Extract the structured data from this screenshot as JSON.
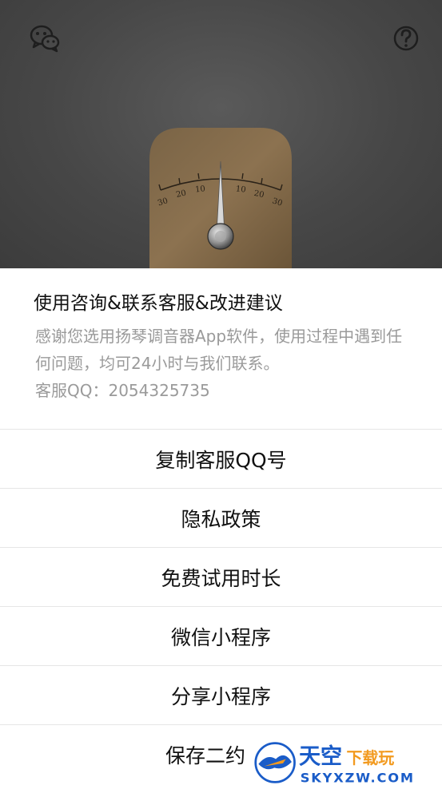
{
  "dialog": {
    "title": "使用咨询&联系客服&改进建议",
    "description": "感谢您选用扬琴调音器App软件，使用过程中遇到任何问题，均可24小时与我们联系。",
    "qq_line": "客服QQ：2054325735"
  },
  "menu": [
    {
      "label": "复制客服QQ号"
    },
    {
      "label": "隐私政策"
    },
    {
      "label": "免费试用时长"
    },
    {
      "label": "微信小程序"
    },
    {
      "label": "分享小程序"
    },
    {
      "label": "保存二约"
    }
  ],
  "tuner": {
    "scale_left": [
      "30",
      "20",
      "10"
    ],
    "scale_right": [
      "10",
      "20",
      "30"
    ]
  },
  "watermark": {
    "brand": "天空",
    "brand_suffix": "下载玩",
    "url": "SKYXZW.COM"
  },
  "colors": {
    "wood_light": "#d9b27a",
    "wood_dark": "#b98a4e",
    "watermark_blue": "#1a5cc8",
    "watermark_orange": "#f29a1f"
  },
  "icons": {
    "top_left": "wechat-icon",
    "top_right": "help-icon"
  }
}
